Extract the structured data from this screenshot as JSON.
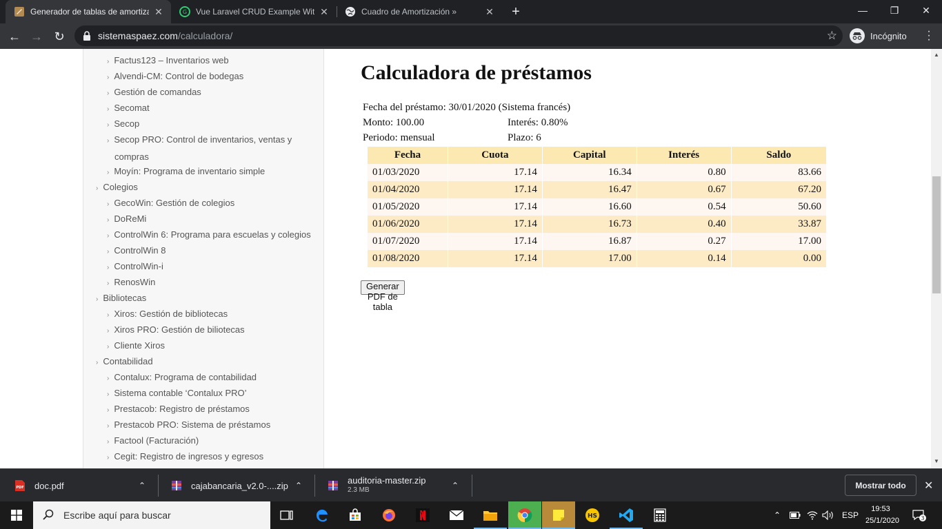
{
  "browser": {
    "tabs": [
      {
        "title": "Generador de tablas de amortiza",
        "active": true
      },
      {
        "title": "Vue Laravel CRUD Example With",
        "active": false
      },
      {
        "title": "Cuadro de Amortización »",
        "active": false
      }
    ],
    "url_host": "sistemaspaez.com",
    "url_path": "/calculadora/",
    "profile_label": "Incógnito"
  },
  "sidebar": {
    "items": [
      {
        "label": "Factus123 – Inventarios web",
        "level": 2
      },
      {
        "label": "Alvendi-CM: Control de bodegas",
        "level": 2
      },
      {
        "label": "Gestión de comandas",
        "level": 2
      },
      {
        "label": "Secomat",
        "level": 2
      },
      {
        "label": "Secop",
        "level": 2
      },
      {
        "label": "Secop PRO: Control de inventarios, ventas y",
        "cont": "compras",
        "level": 2
      },
      {
        "label": "Moyín: Programa de inventario simple",
        "level": 2
      },
      {
        "label": "Colegios",
        "level": 1
      },
      {
        "label": "GecoWin: Gestión de colegios",
        "level": 2
      },
      {
        "label": "DoReMi",
        "level": 2
      },
      {
        "label": "ControlWin 6: Programa para escuelas y colegios",
        "level": 2
      },
      {
        "label": "ControlWin 8",
        "level": 2
      },
      {
        "label": "ControlWin-i",
        "level": 2
      },
      {
        "label": "RenosWin",
        "level": 2
      },
      {
        "label": "Bibliotecas",
        "level": 1
      },
      {
        "label": "Xiros: Gestión de bibliotecas",
        "level": 2
      },
      {
        "label": "Xiros PRO: Gestión de biliotecas",
        "level": 2
      },
      {
        "label": "Cliente Xiros",
        "level": 2
      },
      {
        "label": "Contabilidad",
        "level": 1
      },
      {
        "label": "Contalux: Programa de contabilidad",
        "level": 2
      },
      {
        "label": "Sistema contable ‘Contalux PRO’",
        "level": 2
      },
      {
        "label": "Prestacob: Registro de préstamos",
        "level": 2
      },
      {
        "label": "Prestacob PRO: Sistema de préstamos",
        "level": 2
      },
      {
        "label": "Factool (Facturación)",
        "level": 2
      },
      {
        "label": "Cegit: Registro de ingresos y egresos",
        "level": 2
      }
    ]
  },
  "main": {
    "title": "Calculadora de préstamos",
    "fecha": "Fecha del préstamo: 30/01/2020 (Sistema francés)",
    "monto": "Monto: 100.00",
    "interes": "Interés: 0.80%",
    "periodo": "Periodo: mensual",
    "plazo": "Plazo: 6",
    "table": {
      "headers": [
        "Fecha",
        "Cuota",
        "Capital",
        "Interés",
        "Saldo"
      ],
      "rows": [
        [
          "01/03/2020",
          "17.14",
          "16.34",
          "0.80",
          "83.66"
        ],
        [
          "01/04/2020",
          "17.14",
          "16.47",
          "0.67",
          "67.20"
        ],
        [
          "01/05/2020",
          "17.14",
          "16.60",
          "0.54",
          "50.60"
        ],
        [
          "01/06/2020",
          "17.14",
          "16.73",
          "0.40",
          "33.87"
        ],
        [
          "01/07/2020",
          "17.14",
          "16.87",
          "0.27",
          "17.00"
        ],
        [
          "01/08/2020",
          "17.14",
          "17.00",
          "0.14",
          "0.00"
        ]
      ]
    },
    "pdf_button": "Generar PDF de tabla"
  },
  "downloads": {
    "items": [
      {
        "name": "doc.pdf",
        "sub": ""
      },
      {
        "name": "cajabancaria_v2.0-....zip",
        "sub": ""
      },
      {
        "name": "auditoria-master.zip",
        "sub": "2.3 MB"
      }
    ],
    "show_all": "Mostrar todo"
  },
  "taskbar": {
    "search_placeholder": "Escribe aquí para buscar",
    "lang": "ESP",
    "time": "19:53",
    "date": "25/1/2020",
    "notifications": "3"
  }
}
